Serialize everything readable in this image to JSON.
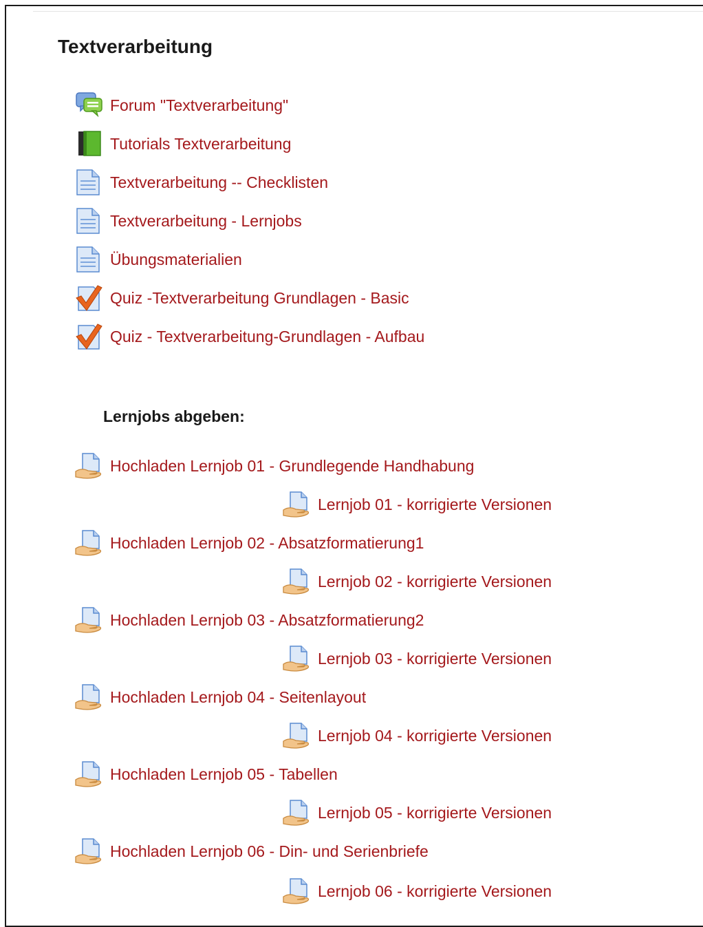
{
  "section": {
    "title": "Textverarbeitung"
  },
  "activities": [
    {
      "label": "Forum \"Textverarbeitung\"",
      "icon": "forum-icon"
    },
    {
      "label": "Tutorials Textverarbeitung",
      "icon": "book-icon"
    },
    {
      "label": "Textverarbeitung -- Checklisten",
      "icon": "page-icon"
    },
    {
      "label": "Textverarbeitung - Lernjobs",
      "icon": "page-icon"
    },
    {
      "label": "Übungsmaterialien",
      "icon": "page-icon"
    },
    {
      "label": "Quiz -Textverarbeitung Grundlagen - Basic",
      "icon": "quiz-icon"
    },
    {
      "label": "Quiz - Textverarbeitung-Grundlagen - Aufbau",
      "icon": "quiz-icon"
    }
  ],
  "assignments": {
    "heading": "Lernjobs abgeben:",
    "items": [
      {
        "label": "Hochladen Lernjob 01 - Grundlegende Handhabung",
        "icon": "assignment-icon"
      },
      {
        "label": "Lernjob 01 - korrigierte Versionen",
        "icon": "assignment-icon"
      },
      {
        "label": "Hochladen Lernjob 02 - Absatzformatierung1",
        "icon": "assignment-icon"
      },
      {
        "label": "Lernjob 02 - korrigierte Versionen",
        "icon": "assignment-icon"
      },
      {
        "label": "Hochladen Lernjob 03 - Absatzformatierung2",
        "icon": "assignment-icon"
      },
      {
        "label": "Lernjob 03 - korrigierte Versionen",
        "icon": "assignment-icon"
      },
      {
        "label": "Hochladen Lernjob 04 - Seitenlayout",
        "icon": "assignment-icon"
      },
      {
        "label": "Lernjob 04 - korrigierte Versionen",
        "icon": "assignment-icon"
      },
      {
        "label": "Hochladen Lernjob 05 - Tabellen",
        "icon": "assignment-icon"
      },
      {
        "label": "Lernjob 05 - korrigierte Versionen",
        "icon": "assignment-icon"
      },
      {
        "label": "Hochladen Lernjob 06 - Din- und Serienbriefe",
        "icon": "assignment-icon"
      },
      {
        "label": "Lernjob 06 - korrigierte Versionen",
        "icon": "assignment-icon"
      }
    ]
  },
  "colors": {
    "link": "#a4191c",
    "heading": "#1a1a1a"
  }
}
